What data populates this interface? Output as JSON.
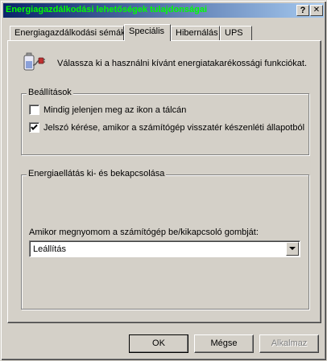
{
  "window": {
    "title": "Energiagazdálkodási lehetőségek tulajdonságai",
    "help_glyph": "?",
    "close_glyph": "✕"
  },
  "tabs": [
    {
      "label": "Energiagazdálkodási sémák",
      "active": false
    },
    {
      "label": "Speciális",
      "active": true
    },
    {
      "label": "Hibernálás",
      "active": false
    },
    {
      "label": "UPS",
      "active": false
    }
  ],
  "panel": {
    "icon": "battery-plug-icon",
    "intro": "Válassza ki a használni kívánt energiatakarékossági funkciókat.",
    "settings": {
      "label": "Beállítások",
      "options": [
        {
          "label": "Mindig jelenjen meg az ikon a tálcán",
          "checked": false
        },
        {
          "label": "Jelszó kérése, amikor a számítógép visszatér készenléti állapotból",
          "checked": true
        }
      ]
    },
    "power_buttons": {
      "label": "Energiaellátás ki- és bekapcsolása",
      "field_label": "Amikor megnyomom a számítógép be/kikapcsoló gombját:",
      "selected": "Leállítás"
    }
  },
  "buttons": {
    "ok": "OK",
    "cancel": "Mégse",
    "apply": "Alkalmaz"
  },
  "colors": {
    "title_text": "#00ff00",
    "title_bar_start": "#0a246a",
    "title_bar_end": "#a6caf0",
    "face": "#d4d0c8"
  }
}
